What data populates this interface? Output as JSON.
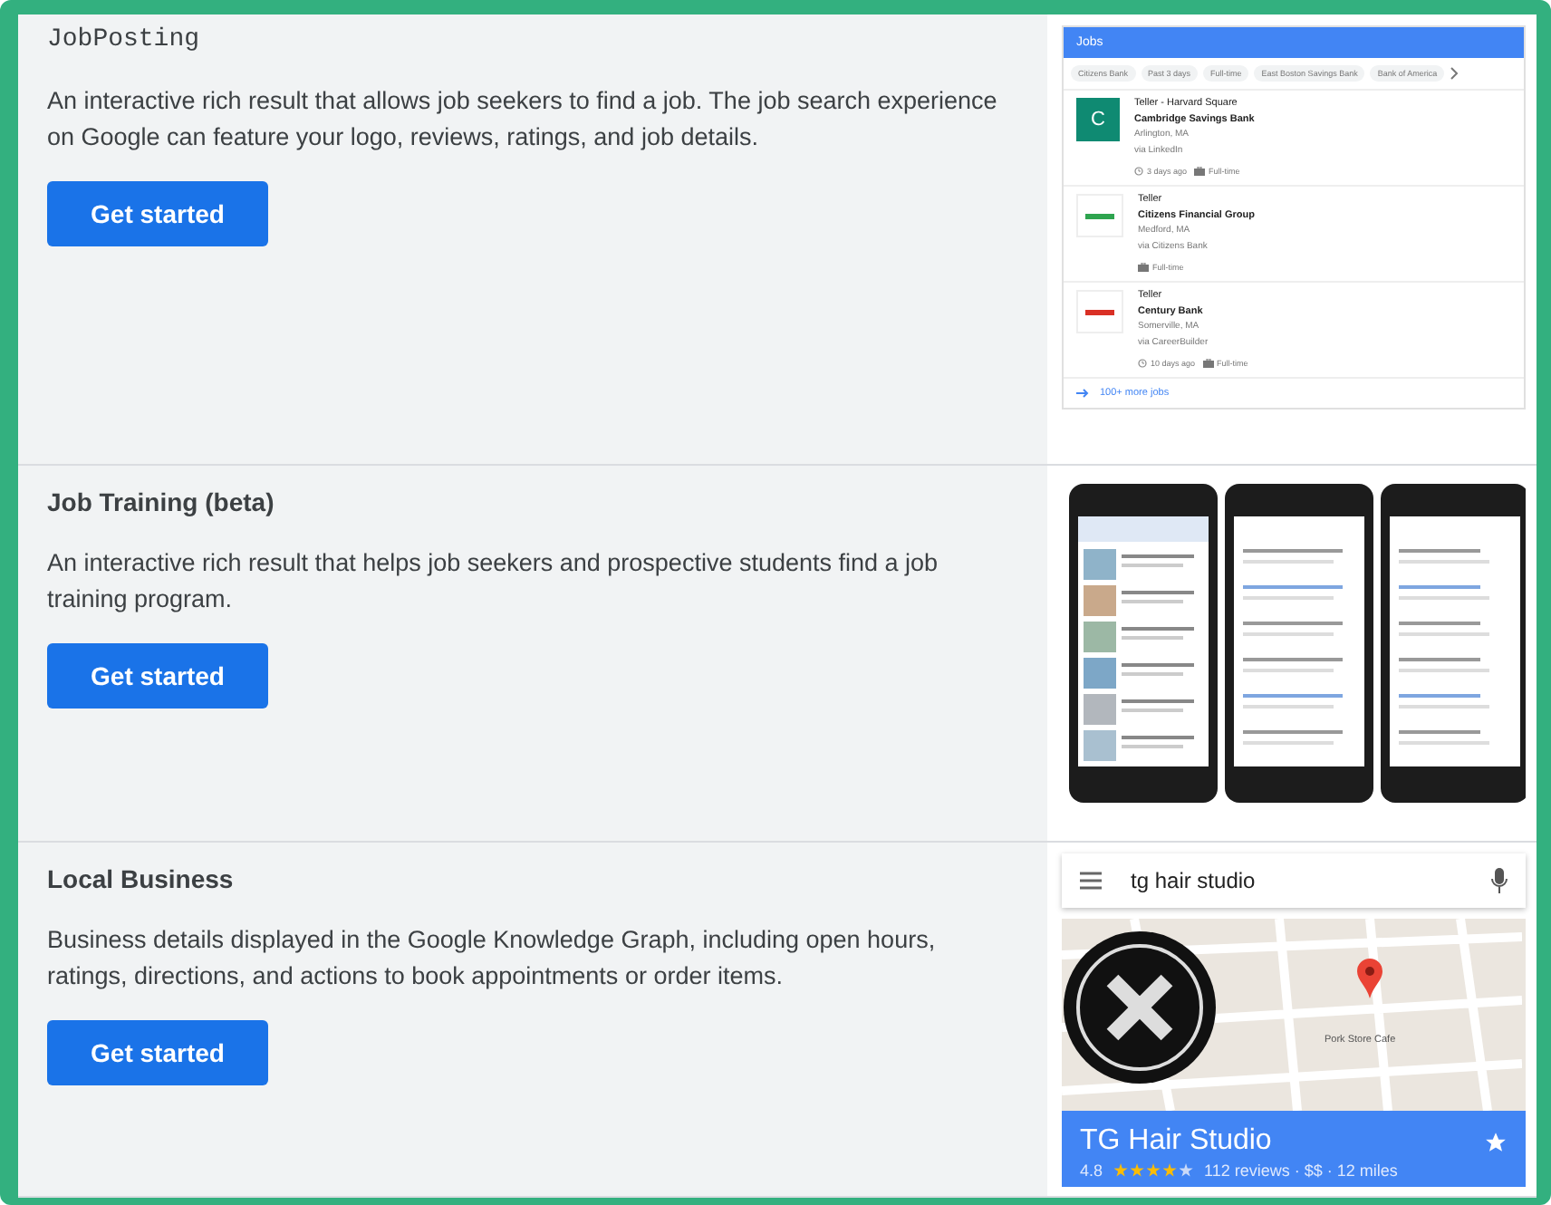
{
  "sections": [
    {
      "title": "JobPosting",
      "kind": "code",
      "description": "An interactive rich result that allows job seekers to find a job. The job search experience on Google can feature your logo, reviews, ratings, and job details.",
      "button": "Get started",
      "preview": {
        "kind": "jobs",
        "header": "Jobs",
        "chips": [
          "Citizens Bank",
          "Past 3 days",
          "Full-time",
          "East Boston Savings Bank",
          "Bank of America"
        ],
        "jobs": [
          {
            "logo": {
              "kind": "letter",
              "text": "C",
              "color": "#0f8a72"
            },
            "title": "Teller - Harvard Square",
            "company": "Cambridge Savings Bank",
            "location": "Arlington, MA",
            "via": "via LinkedIn",
            "posted": "3 days ago",
            "type": "Full-time"
          },
          {
            "logo": {
              "kind": "mark",
              "color": "#2ea44f"
            },
            "title": "Teller",
            "company": "Citizens Financial Group",
            "location": "Medford, MA",
            "via": "via Citizens Bank",
            "type": "Full-time"
          },
          {
            "logo": {
              "kind": "mark",
              "color": "#d93025"
            },
            "title": "Teller",
            "company": "Century Bank",
            "location": "Somerville, MA",
            "via": "via CareerBuilder",
            "posted": "10 days ago",
            "type": "Full-time"
          }
        ],
        "more": "100+ more jobs"
      }
    },
    {
      "title": "Job Training (beta)",
      "kind": "plain",
      "description": "An interactive rich result that helps job seekers and prospective students find a job training program.",
      "button": "Get started",
      "preview": {
        "kind": "phones"
      }
    },
    {
      "title": "Local Business",
      "kind": "plain",
      "description": "Business details displayed in the Google Knowledge Graph, including open hours, ratings, directions, and actions to book appointments or order items.",
      "button": "Get started",
      "preview": {
        "kind": "local",
        "query": "tg hair studio",
        "place": "Pork Store Cafe",
        "name": "TG Hair Studio",
        "rating": "4.8",
        "stars": 4,
        "details": "112 reviews · $$ · 12 miles"
      }
    }
  ]
}
